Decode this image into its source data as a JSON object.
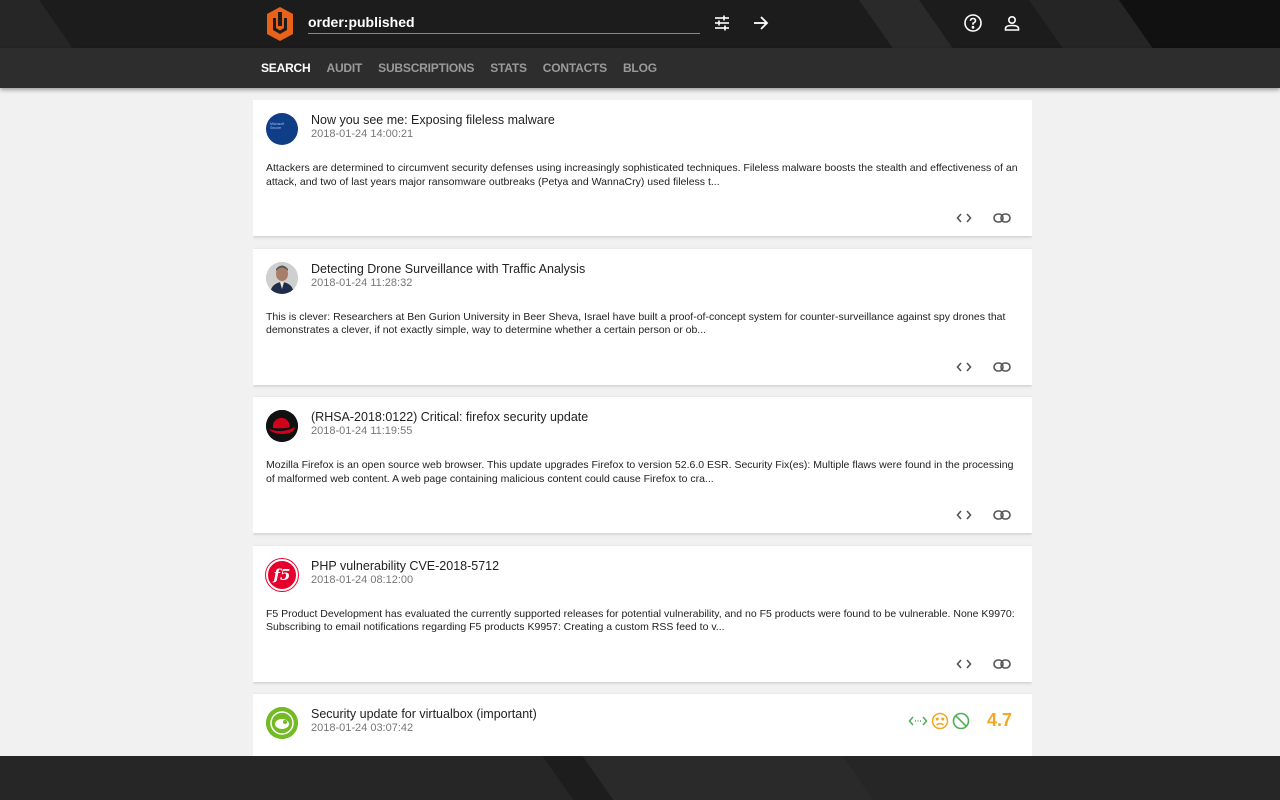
{
  "header": {
    "search_value": "order:published",
    "filter_icon": "tune-icon",
    "go_icon": "arrow-right-icon",
    "help_icon": "help-circle-icon",
    "user_icon": "user-icon"
  },
  "nav": {
    "items": [
      "SEARCH",
      "AUDIT",
      "SUBSCRIPTIONS",
      "STATS",
      "CONTACTS",
      "BLOG"
    ],
    "active": "SEARCH"
  },
  "colors": {
    "accent": "#e8621a",
    "score": "#f5a623",
    "score_icons": "#4caf50"
  },
  "feed": [
    {
      "avatar": "microsoft-secure-logo",
      "avatar_text": "Microsoft Secure",
      "title": "Now you see me: Exposing fileless malware",
      "date": "2018-01-24 14:00:21",
      "description": "Attackers are determined to circumvent security defenses using increasingly sophisticated techniques. Fileless malware boosts the stealth and effectiveness of an attack, and two of last years major ransomware outbreaks (Petya and WannaCry) used fileless t..."
    },
    {
      "avatar": "author-photo",
      "title": "Detecting Drone Surveillance with Traffic Analysis",
      "date": "2018-01-24 11:28:32",
      "description": "This is clever: Researchers at Ben Gurion University in Beer Sheva, Israel have built a proof-of-concept system for counter-surveillance against spy drones that demonstrates a clever, if not exactly simple, way to determine whether a certain person or ob..."
    },
    {
      "avatar": "redhat-logo",
      "title": "(RHSA-2018:0122) Critical: firefox security update",
      "date": "2018-01-24 11:19:55",
      "description": "Mozilla Firefox is an open source web browser. This update upgrades Firefox to version 52.6.0 ESR. Security Fix(es): Multiple flaws were found in the processing of malformed web content. A web page containing malicious content could cause Firefox to cra..."
    },
    {
      "avatar": "f5-logo",
      "avatar_text": "f5",
      "title": "PHP vulnerability CVE-2018-5712",
      "date": "2018-01-24 08:12:00",
      "description": "F5 Product Development has evaluated the currently supported releases for potential vulnerability, and no F5 products were found to be vulnerable. None K9970: Subscribing to email notifications regarding F5 products K9957: Creating a custom RSS feed to v..."
    },
    {
      "avatar": "opensuse-logo",
      "title": "Security update for virtualbox (important)",
      "date": "2018-01-24 03:07:42",
      "description": "",
      "score": "4.7",
      "score_icons": [
        "code-icon",
        "sad-face-icon",
        "block-icon"
      ]
    }
  ]
}
